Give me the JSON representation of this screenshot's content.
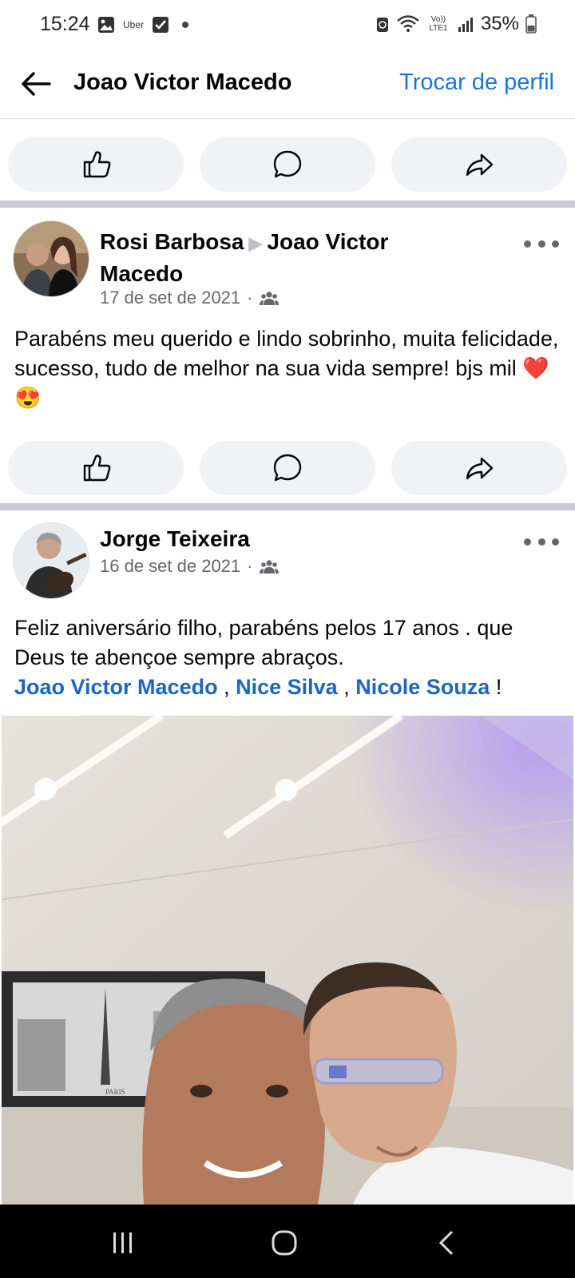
{
  "status_bar": {
    "time": "15:24",
    "notification_uber": "Uber",
    "network": "Vo)) LTE1",
    "battery": "35%"
  },
  "header": {
    "title": "Joao Victor Macedo",
    "switch_profile": "Trocar de perfil"
  },
  "posts": [
    {
      "author": "Rosi Barbosa",
      "recipient": "Joao Victor Macedo",
      "date": "17 de set de 2021",
      "dot": "·",
      "audience_icon": "friends-icon",
      "text": "Parabéns meu querido e lindo sobrinho, muita felicidade, sucesso, tudo de melhor na sua vida sempre! bjs mil",
      "emojis": "❤️😍"
    },
    {
      "author": "Jorge Teixeira",
      "date": "16 de set de 2021",
      "dot": "·",
      "audience_icon": "friends-icon",
      "text": "Feliz aniversário filho, parabéns pelos 17 anos . que Deus te abençoe sempre abraços.",
      "mentions": [
        "Joao Victor Macedo",
        "Nice Silva",
        "Nicole Souza"
      ],
      "mention_sep": ",",
      "mention_end": "!",
      "photo_caption": "PARIS"
    }
  ],
  "colors": {
    "accent": "#1b74e4",
    "mention": "#1b65c5",
    "button_bg": "#f0f2f5",
    "separator": "#c9ccd1",
    "meta": "#65676b"
  }
}
